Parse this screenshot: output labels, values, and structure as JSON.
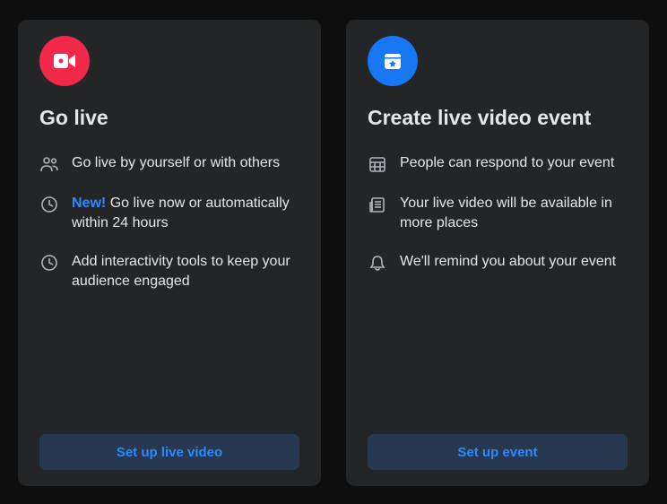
{
  "goLive": {
    "title": "Go live",
    "features": [
      {
        "text": "Go live by yourself or with others"
      },
      {
        "badge": "New!",
        "text": "Go live now or automatically within 24 hours"
      },
      {
        "text": "Add interactivity tools to keep your audience engaged"
      }
    ],
    "cta": "Set up live video"
  },
  "event": {
    "title": "Create live video event",
    "features": [
      {
        "text": "People can respond to your event"
      },
      {
        "text": "Your live video will be available in more places"
      },
      {
        "text": "We'll remind you about your event"
      }
    ],
    "cta": "Set up event"
  }
}
